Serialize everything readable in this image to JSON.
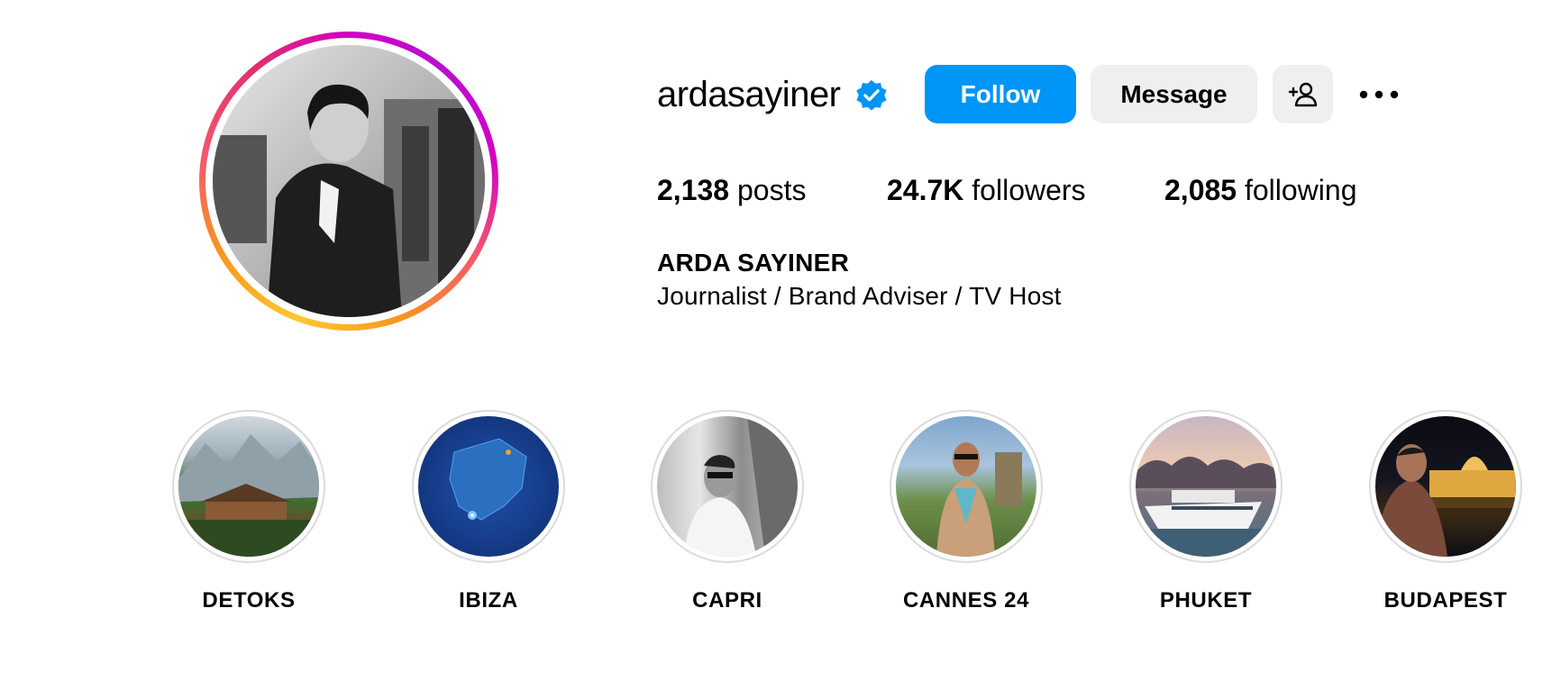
{
  "profile": {
    "username": "ardasayiner",
    "verified": true,
    "full_name": "ARDA SAYINER",
    "bio": "Journalist / Brand Adviser / TV Host"
  },
  "actions": {
    "follow_label": "Follow",
    "message_label": "Message",
    "add_user_icon": "add-user-icon",
    "more_icon": "more-horizontal-icon"
  },
  "stats": {
    "posts": {
      "value": "2,138",
      "label": "posts"
    },
    "followers": {
      "value": "24.7K",
      "label": "followers"
    },
    "following": {
      "value": "2,085",
      "label": "following"
    }
  },
  "highlights": [
    {
      "label": "DETOKS"
    },
    {
      "label": "IBIZA"
    },
    {
      "label": "CAPRI"
    },
    {
      "label": "CANNES 24"
    },
    {
      "label": "PHUKET"
    },
    {
      "label": "BUDAPEST"
    }
  ],
  "colors": {
    "follow_button": "#0095f6",
    "secondary_button": "#efefef",
    "verified_badge": "#0095f6",
    "text": "#000000"
  }
}
